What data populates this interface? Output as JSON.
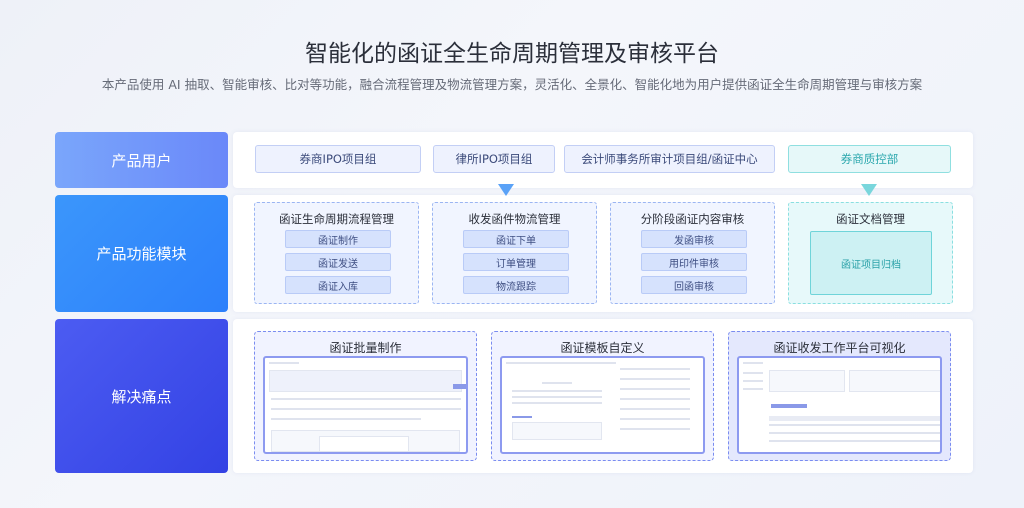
{
  "header": {
    "title": "智能化的函证全生命周期管理及审核平台",
    "subtitle": "本产品使用 AI 抽取、智能审核、比对等功能，融合流程管理及物流管理方案，灵活化、全景化、智能化地为用户提供函证全生命周期管理与审核方案"
  },
  "rows": {
    "users": "产品用户",
    "modules": "产品功能模块",
    "solutions": "解决痛点"
  },
  "users": [
    "券商IPO项目组",
    "律所IPO项目组",
    "会计师事务所审计项目组/函证中心",
    "券商质控部"
  ],
  "modules": [
    {
      "title": "函证生命周期流程管理",
      "items": [
        "函证制作",
        "函证发送",
        "函证入库"
      ]
    },
    {
      "title": "收发函件物流管理",
      "items": [
        "函证下单",
        "订单管理",
        "物流跟踪"
      ]
    },
    {
      "title": "分阶段函证内容审核",
      "items": [
        "发函审核",
        "用印件审核",
        "回函审核"
      ]
    },
    {
      "title": "函证文档管理",
      "items": [
        "函证项目归档"
      ]
    }
  ],
  "solutions": [
    {
      "title": "函证批量制作"
    },
    {
      "title": "函证模板自定义"
    },
    {
      "title": "函证收发工作平台可视化"
    }
  ],
  "colors": {
    "users_label": "#6e92f9",
    "modules_label": "#2f86fb",
    "solutions_label": "#3e50e8",
    "teal": "#2aa7ad"
  }
}
